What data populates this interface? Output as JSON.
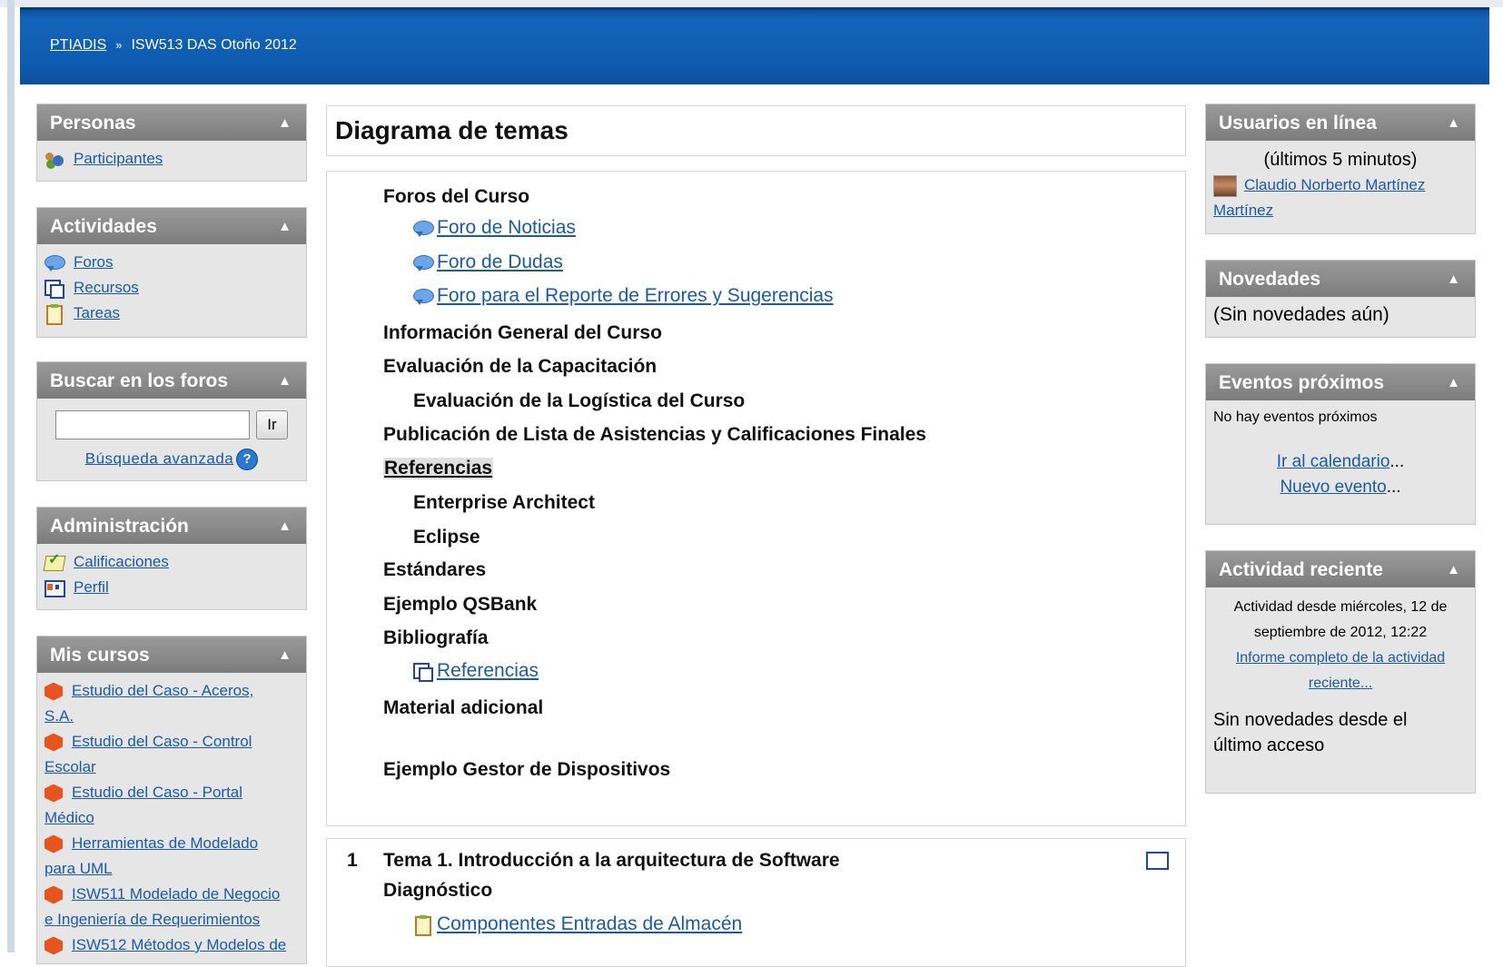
{
  "breadcrumb": {
    "home": "PTIADIS",
    "separator": "»",
    "current": "ISW513 DAS Otoño 2012"
  },
  "left": {
    "personas": {
      "title": "Personas",
      "items": [
        {
          "label": "Participantes",
          "icon": "people-icon"
        }
      ]
    },
    "actividades": {
      "title": "Actividades",
      "items": [
        {
          "label": "Foros",
          "icon": "chat-icon"
        },
        {
          "label": "Recursos",
          "icon": "resource-icon"
        },
        {
          "label": "Tareas",
          "icon": "task-icon"
        }
      ]
    },
    "buscar": {
      "title": "Buscar en los foros",
      "input_value": "",
      "button": "Ir",
      "advanced": "Búsqueda avanzada"
    },
    "administracion": {
      "title": "Administración",
      "items": [
        {
          "label": "Calificaciones",
          "icon": "grades-icon"
        },
        {
          "label": "Perfil",
          "icon": "profile-icon"
        }
      ]
    },
    "mis_cursos": {
      "title": "Mis cursos",
      "items": [
        {
          "line1": "Estudio del Caso - Aceros,",
          "line2": "S.A."
        },
        {
          "line1": "Estudio del Caso - Control",
          "line2": "Escolar"
        },
        {
          "line1": "Estudio del Caso - Portal",
          "line2": "Médico"
        },
        {
          "line1": "Herramientas de Modelado",
          "line2": "para UML"
        },
        {
          "line1": "ISW511 Modelado de Negocio",
          "line2": "e Ingeniería de Requerimientos"
        },
        {
          "line1": "ISW512 Métodos y Modelos de",
          "line2": ""
        }
      ]
    }
  },
  "main": {
    "title": "Diagrama de temas",
    "section0": [
      {
        "type": "heading",
        "text": "Foros del Curso",
        "indent": 0
      },
      {
        "type": "link",
        "text": " Foro de Noticias",
        "icon": "chat-icon"
      },
      {
        "type": "link",
        "text": " Foro de Dudas",
        "icon": "chat-icon"
      },
      {
        "type": "link",
        "text": " Foro para el Reporte de Errores y Sugerencias",
        "icon": "chat-icon"
      },
      {
        "type": "heading",
        "text": "Información General del Curso",
        "indent": 0
      },
      {
        "type": "heading",
        "text": "Evaluación de la Capacitación",
        "indent": 0
      },
      {
        "type": "heading",
        "text": "Evaluación de la Logística del Curso",
        "indent": 1
      },
      {
        "type": "heading",
        "text": "Publicación de Lista de Asistencias y Calificaciones Finales",
        "indent": 0
      },
      {
        "type": "heading",
        "text": "Referencias",
        "indent": 0,
        "highlight": true
      },
      {
        "type": "heading",
        "text": "Enterprise Architect",
        "indent": 1
      },
      {
        "type": "heading",
        "text": "Eclipse",
        "indent": 1
      },
      {
        "type": "heading",
        "text": "Estándares",
        "indent": 0
      },
      {
        "type": "heading",
        "text": "Ejemplo QSBank",
        "indent": 0
      },
      {
        "type": "heading",
        "text": "Bibliografía",
        "indent": 0
      },
      {
        "type": "link",
        "text": " Referencias",
        "icon": "resource-icon"
      },
      {
        "type": "heading",
        "text": "Material adicional",
        "indent": 0
      },
      {
        "type": "heading",
        "text": "Ejemplo Gestor de Dispositivos",
        "indent": 0
      }
    ],
    "section1": {
      "number": "1",
      "title": "Tema 1. Introducción a la arquitectura de Software",
      "subheading": "Diagnóstico",
      "link": " Componentes Entradas de Almacén"
    }
  },
  "right": {
    "usuarios": {
      "title": "Usuarios en línea",
      "subtitle": "(últimos 5 minutos)",
      "user_line1": "Claudio Norberto Martínez",
      "user_line2": "Martínez"
    },
    "novedades": {
      "title": "Novedades",
      "text": "(Sin novedades aún)"
    },
    "eventos": {
      "title": "Eventos próximos",
      "text": "No hay eventos próximos",
      "link1": "Ir al calendario",
      "link2": "Nuevo evento",
      "ellipsis": "..."
    },
    "actividad": {
      "title": "Actividad reciente",
      "line1": "Actividad desde miércoles, 12 de",
      "line2": "septiembre de 2012, 12:22",
      "link1": "Informe completo de la actividad",
      "link2": "reciente...",
      "note1": "Sin novedades desde el",
      "note2": "último acceso"
    }
  },
  "block_toggle": "▲"
}
